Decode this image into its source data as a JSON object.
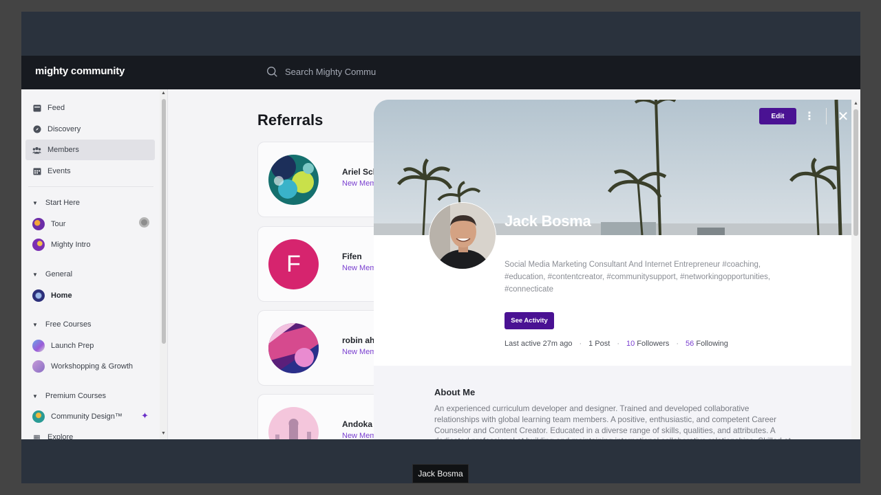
{
  "header": {
    "logo": "mighty community",
    "search_placeholder": "Search Mighty Commu"
  },
  "sidebar": {
    "items": [
      {
        "label": "Feed",
        "icon": "feed-icon"
      },
      {
        "label": "Discovery",
        "icon": "compass-icon"
      },
      {
        "label": "Members",
        "icon": "members-icon",
        "active": true
      },
      {
        "label": "Events",
        "icon": "calendar-icon"
      }
    ],
    "sections": [
      {
        "label": "Start Here",
        "items": [
          "Tour",
          "Mighty Intro"
        ]
      },
      {
        "label": "General",
        "items": [
          "Home"
        ]
      },
      {
        "label": "Free Courses",
        "items": [
          "Launch Prep",
          "Workshopping & Growth"
        ]
      },
      {
        "label": "Premium Courses",
        "items": [
          "Community Design™",
          "Explore"
        ]
      }
    ]
  },
  "main": {
    "title": "Referrals",
    "cards": [
      {
        "name": "Ariel Sch",
        "status": "New Mem"
      },
      {
        "name": "Fifen",
        "status": "New Mem",
        "initial": "F"
      },
      {
        "name": "robin ah",
        "status": "New Mem"
      },
      {
        "name": "Andoka",
        "status": "New Memb"
      }
    ]
  },
  "profile": {
    "edit_label": "Edit",
    "name": "Jack Bosma",
    "bio": "Social Media Marketing Consultant And Internet Entrepreneur #coaching, #education, #contentcreator, #communitysupport, #networkingopportunities, #connecticate",
    "activity_label": "See Activity",
    "last_active": "Last active 27m ago",
    "posts": "1 Post",
    "followers_count": "10",
    "followers_label": "Followers",
    "following_count": "56",
    "following_label": "Following",
    "about_title": "About Me",
    "about_text": "An experienced curriculum developer and designer. Trained and developed collaborative relationships with global learning team members. A positive, enthusiastic, and competent Career Counselor and Content Creator. Educated in a diverse range of skills, qualities, and attributes. A dedicated professional at building and maintaining international collaborative relationships. Skilled at leading, coaching, resume preparation, interview, job search strategies, and supporting clients using interactive skills with listening, speaking, reading and writing. Educated in the delivery of support programs."
  },
  "tooltip": "Jack Bosma",
  "colors": {
    "accent": "#4a1293",
    "link": "#7a3fd0",
    "topbar": "#171a20",
    "fifen_avatar": "#d6246e"
  }
}
